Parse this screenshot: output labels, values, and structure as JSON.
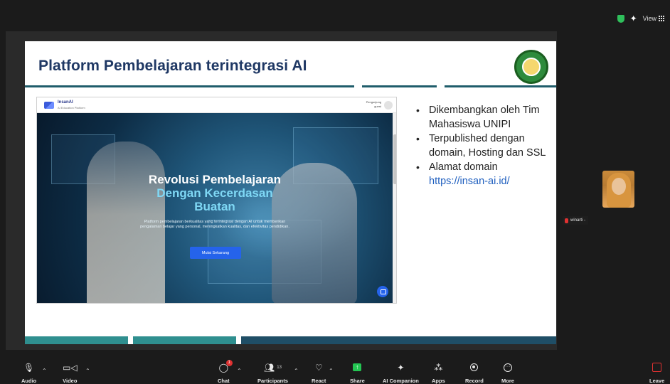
{
  "topbar": {
    "view_label": "View"
  },
  "slide": {
    "title": "Platform Pembelajaran terintegrasi AI",
    "bullets": [
      "Dikembangkan oleh Tim Mahasiswa UNIPI",
      "Terpublished dengan domain, Hosting dan SSL",
      "Alamat domain"
    ],
    "domain_link": "https://insan-ai.id/",
    "colors": {
      "title": "#1f3864",
      "rule": "#1f5d6b",
      "accent": "#2f8f8f"
    }
  },
  "website": {
    "brand_name": "InsanAI",
    "brand_sub": "AI Education Platform",
    "header_right": "Pengunjung guest",
    "hero_line1": "Revolusi Pembelajaran",
    "hero_line2": "Dengan Kecerdasan",
    "hero_line3": "Buatan",
    "hero_desc": "Platform pembelajaran berkualitas yang terintegrasi dengan AI untuk memberikan pengalaman belajar yang personal, meningkatkan kualitas, dan efektivitas pendidikan.",
    "cta_label": "Mulai Sekarang"
  },
  "participant": {
    "name": "winarti -"
  },
  "toolbar": {
    "audio": "Audio",
    "video": "Video",
    "chat": "Chat",
    "chat_badge": "1",
    "participants": "Participants",
    "participants_count": "13",
    "react": "React",
    "share": "Share",
    "ai_companion": "AI Companion",
    "apps": "Apps",
    "record": "Record",
    "more": "More",
    "leave": "Leave"
  }
}
